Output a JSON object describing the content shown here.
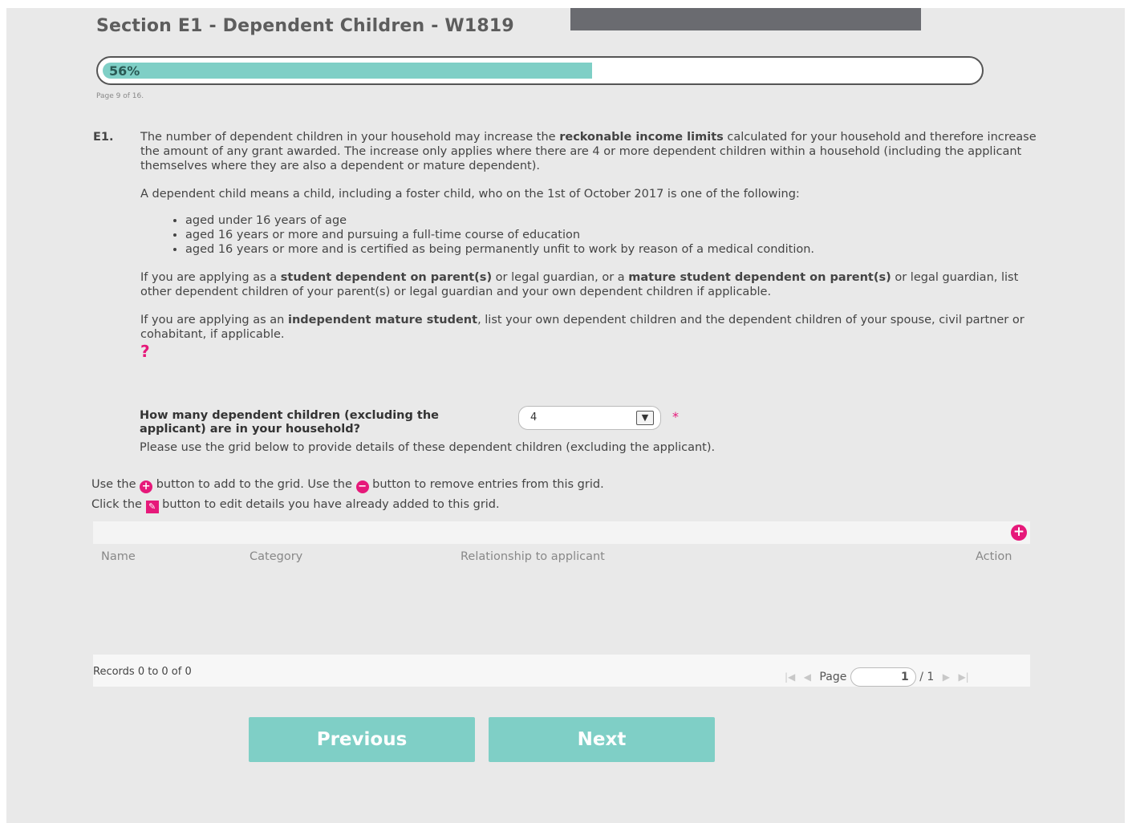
{
  "header": {
    "title": "Section E1 - Dependent Children - W1819"
  },
  "progress": {
    "percent_label": "56%",
    "percent": 56,
    "page_text": "Page 9 of 16."
  },
  "question_block": {
    "label": "E1.",
    "p1_pre": "The number of dependent children in your household may increase the ",
    "p1_bold": "reckonable income limits",
    "p1_post": " calculated for your household and therefore increase the amount of any grant awarded. The increase only applies where there are 4 or more dependent children within a household (including the applicant themselves where they are also a dependent or mature dependent).",
    "p2": "A dependent child means a child, including a foster child, who on the 1st of October 2017 is one of the following:",
    "bullets": [
      "aged under 16 years of age",
      "aged 16 years or more and pursuing a full-time course of education",
      "aged 16 years or more and is certified as being permanently unfit to work by reason of a medical condition."
    ],
    "p3_a": "If you are applying as a ",
    "p3_b": "student dependent on parent(s)",
    "p3_c": " or legal guardian, or a ",
    "p3_d": "mature student dependent on parent(s)",
    "p3_e": " or legal guardian, list other dependent children of your parent(s) or legal guardian and your own dependent children if applicable.",
    "p4_a": "If you are applying as an ",
    "p4_b": "independent mature student",
    "p4_c": ", list your own dependent children and the dependent children of your spouse, civil partner or cohabitant, if applicable.",
    "help_symbol": "?"
  },
  "form": {
    "question": "How many dependent children (excluding the applicant) are in your household?",
    "selected_value": "4",
    "required_mark": "*",
    "grid_hint": "Please use the grid below to provide details of these dependent children (excluding the applicant)."
  },
  "instructions": {
    "line1_a": "Use the ",
    "line1_b": " button to add to the grid. Use the ",
    "line1_c": " button to remove entries from this grid.",
    "line2_a": "Click the ",
    "line2_b": " button to edit details you have already added to this grid."
  },
  "grid": {
    "columns": [
      "Name",
      "Category",
      "Relationship to applicant",
      "Action"
    ],
    "rows": [],
    "records_text": "Records 0 to 0 of 0",
    "page_label": "Page",
    "page_value": "1",
    "page_total": "/ 1"
  },
  "nav": {
    "previous": "Previous",
    "next": "Next"
  },
  "colors": {
    "accent": "#7fcfc6",
    "pink": "#e6197a"
  }
}
